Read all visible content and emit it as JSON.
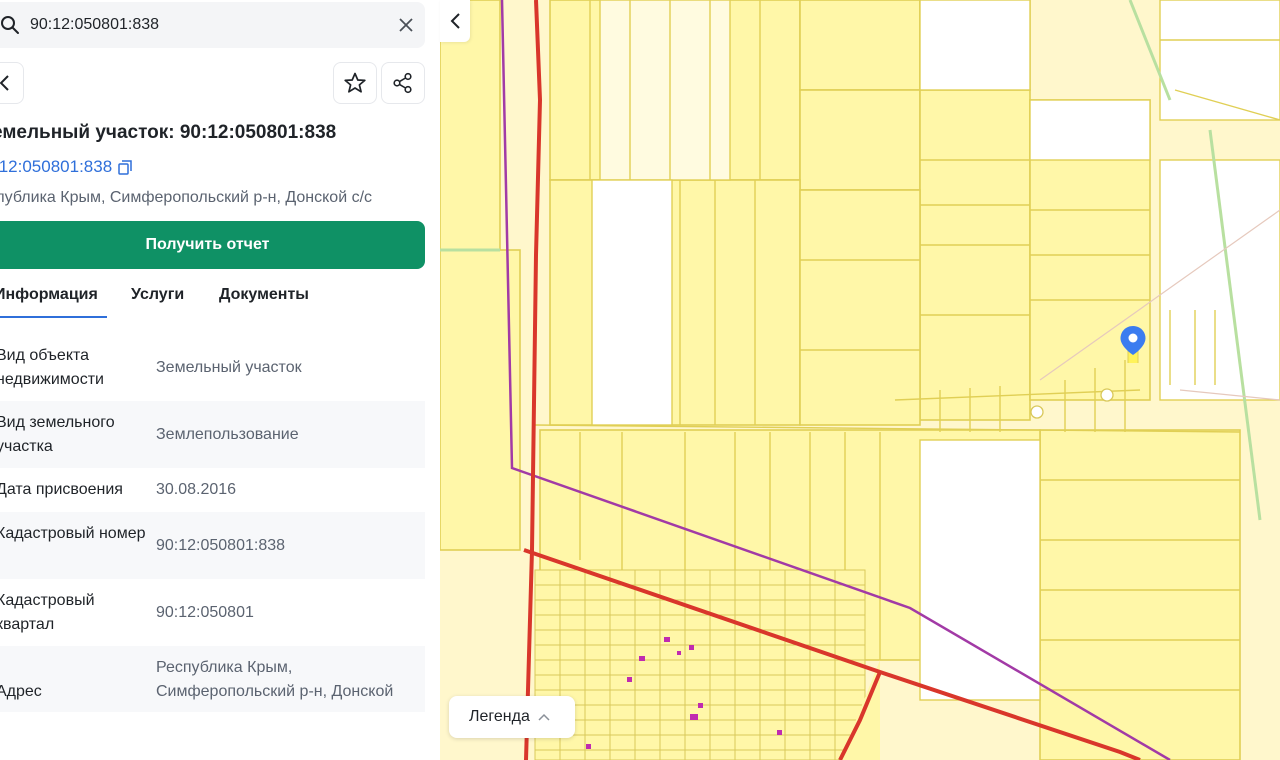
{
  "search": {
    "value": "90:12:050801:838",
    "icon": "search-icon",
    "clear_icon": "close-icon"
  },
  "header": {
    "back_icon": "chevron-left-icon",
    "favorite_icon": "star-icon",
    "share_icon": "share-icon"
  },
  "object": {
    "title": "емельный участок: 90:12:050801:838",
    "cadastral_link": ":12:050801:838",
    "address_short": "спублика Крым, Симферопольский р-н, Донской с/с"
  },
  "actions": {
    "report_label": "Получить отчет"
  },
  "tabs": [
    {
      "label": "Информация",
      "active": true
    },
    {
      "label": "Услуги",
      "active": false
    },
    {
      "label": "Документы",
      "active": false
    }
  ],
  "info": [
    {
      "key": "Вид объекта недвижимости",
      "value": "Земельный участок"
    },
    {
      "key": "Вид земельного участка",
      "value": "Землепользование"
    },
    {
      "key": "Дата присвоения",
      "value": "30.08.2016"
    },
    {
      "key": "Кадастровый номер",
      "value": "90:12:050801:838"
    },
    {
      "key": "Кадастровый квартал",
      "value": "90:12:050801"
    },
    {
      "key": "Адрес",
      "value": "Республика Крым, Симферопольский р-н, Донской"
    }
  ],
  "map": {
    "legend_label": "Легенда",
    "collapse_icon": "chevron-left-icon",
    "marker_icon": "location-pin-icon"
  },
  "colors": {
    "accent_green": "#0f9165",
    "link_blue": "#2f6fda",
    "parcel_fill": "#fff7a8",
    "parcel_stroke": "#e0cf55",
    "boundary_red": "#d9362b",
    "boundary_purple": "#a23aa6"
  }
}
